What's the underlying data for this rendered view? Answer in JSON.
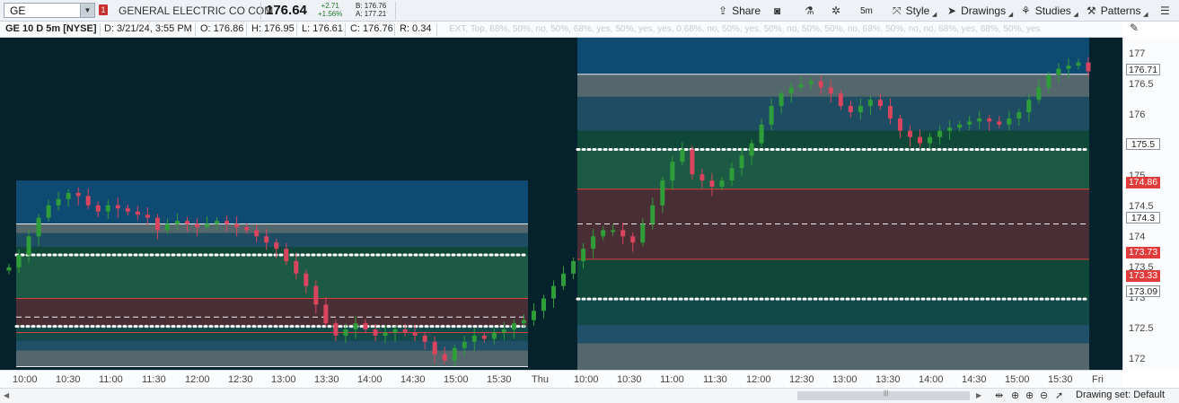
{
  "toolbar": {
    "symbol": "GE",
    "symbol_dropdown_icon": "chevron-down-icon",
    "alert_count": "1",
    "company": "GENERAL ELECTRIC CO COM",
    "last": "176.64",
    "change_abs": "+2.71",
    "change_pct": "+1.56%",
    "bid": "B: 176.76",
    "ask": "A: 177.21",
    "buttons": {
      "share": "Share",
      "style": "Style",
      "drawings": "Drawings",
      "studies": "Studies",
      "patterns": "Patterns",
      "timeframe": "5m"
    }
  },
  "status": {
    "title": "GE 10 D 5m [NYSE]",
    "date": "D: 3/21/24, 3:55 PM",
    "open": "O: 176.86",
    "high": "H: 176.95",
    "low": "L: 176.61",
    "close": "C: 176.76",
    "range": "R: 0.34",
    "overlay_labels": "EXT, Top, 68%, 50%, no, 50%, 68%, yes, 50%, yes, yes, 0.68%, no, 50%, yes, 50%, no, 50%, 50%, no, 68%, 50%, no, no, 68%, yes, 68%, 50%, yes"
  },
  "colors": {
    "background": "#04212c",
    "up_candle": "#2f9e3a",
    "down_candle": "#d9445e",
    "value_area": "#4a2e36",
    "band_blue": "#0f4a72",
    "band_gray": "#53676c",
    "band_green": "#0f4839",
    "marker_red": "#e03c3c"
  },
  "price_axis": {
    "ticks": [
      "177",
      "176.5",
      "176",
      "175",
      "174.5",
      "174",
      "173.5",
      "173",
      "172.5",
      "172"
    ],
    "labels": {
      "last_close": "176.71",
      "level_1": "175.5",
      "va_high": "174.86",
      "poc": "174.3",
      "va_low": "173.73",
      "level_2": "173.33",
      "level_3": "173.09"
    }
  },
  "time_axis": {
    "ticks": [
      "10:00",
      "10:30",
      "11:00",
      "11:30",
      "12:00",
      "12:30",
      "13:00",
      "13:30",
      "14:00",
      "14:30",
      "15:00",
      "15:30",
      "Thu",
      "10:00",
      "10:30",
      "11:00",
      "11:30",
      "12:00",
      "12:30",
      "13:00",
      "13:30",
      "14:00",
      "14:30",
      "15:00",
      "15:30",
      "Fri"
    ]
  },
  "bottom": {
    "drawing_set": "Drawing set: Default",
    "icons": [
      "expand-horizontal-icon",
      "pan-icon",
      "zoom-in-icon",
      "zoom-out-icon",
      "cursor-icon"
    ]
  },
  "chart_data": {
    "type": "candlestick",
    "symbol": "GE",
    "interval": "5m",
    "ylim": [
      171.95,
      177.3
    ],
    "sessions": [
      {
        "day": "Wed",
        "profile": {
          "top": 175.0,
          "high_line": 174.3,
          "level_1": 173.8,
          "va_high": 173.1,
          "poc": 172.8,
          "va_low": 172.55,
          "level_2": 172.65,
          "bottom": 172.0
        }
      },
      {
        "day": "Thu",
        "profile": {
          "top": 177.3,
          "high_line": 176.71,
          "level_1": 175.5,
          "va_high": 174.86,
          "poc": 174.3,
          "va_low": 173.73,
          "level_2": 173.09,
          "bottom": 171.9
        }
      }
    ],
    "closes": [
      173.6,
      173.8,
      174.1,
      174.4,
      174.6,
      174.7,
      174.8,
      174.75,
      174.6,
      174.5,
      174.6,
      174.55,
      174.5,
      174.45,
      174.4,
      174.2,
      174.3,
      174.35,
      174.3,
      174.25,
      174.3,
      174.35,
      174.3,
      174.25,
      174.2,
      174.1,
      174.0,
      173.9,
      173.7,
      173.5,
      173.3,
      173.0,
      172.7,
      172.5,
      172.6,
      172.7,
      172.6,
      172.5,
      172.55,
      172.6,
      172.55,
      172.5,
      172.4,
      172.2,
      172.1,
      172.3,
      172.4,
      172.5,
      172.45,
      172.55,
      172.6,
      172.7,
      172.75,
      172.9,
      173.1,
      173.3,
      173.5,
      173.7,
      173.9,
      174.1,
      174.2,
      174.2,
      174.1,
      174.0,
      174.3,
      174.6,
      175.0,
      175.3,
      175.5,
      175.1,
      175.0,
      174.9,
      175.0,
      175.2,
      175.4,
      175.6,
      175.9,
      176.2,
      176.4,
      176.5,
      176.55,
      176.6,
      176.5,
      176.4,
      176.2,
      176.1,
      176.2,
      176.3,
      176.2,
      176.0,
      175.8,
      175.7,
      175.6,
      175.7,
      175.8,
      175.85,
      175.9,
      175.95,
      176.0,
      175.95,
      175.9,
      176.0,
      176.1,
      176.3,
      176.5,
      176.7,
      176.8,
      176.85,
      176.9,
      176.76
    ]
  }
}
